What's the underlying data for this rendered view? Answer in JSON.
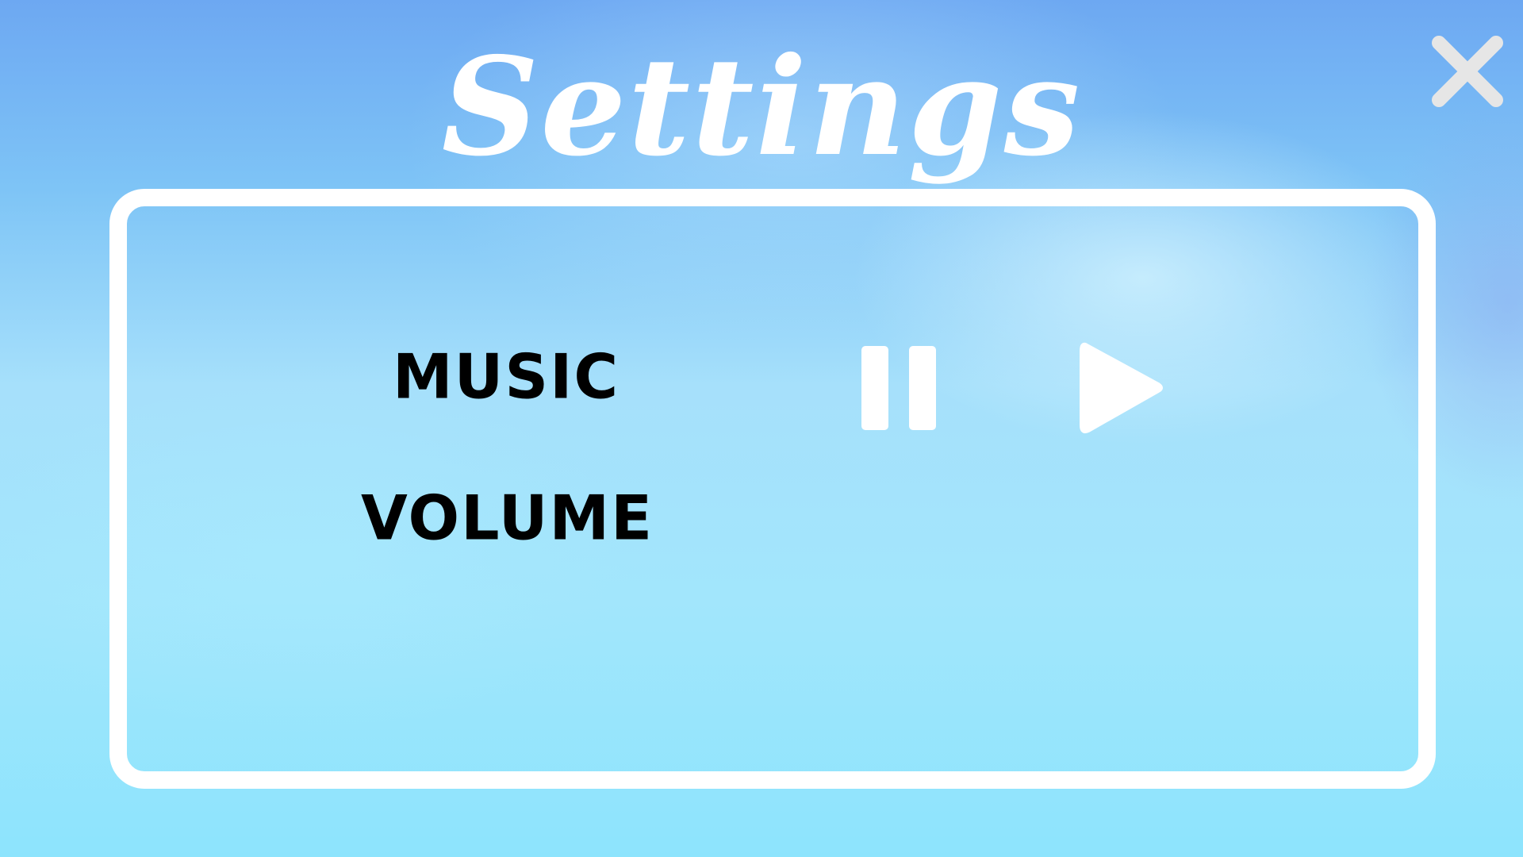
{
  "screen": {
    "title": "Settings"
  },
  "settings": {
    "music_label": "MUSIC",
    "volume_label": "VOLUME"
  },
  "controls": {
    "close_icon": "close-x-icon",
    "pause_icon": "pause-icon",
    "play_icon": "play-icon"
  },
  "colors": {
    "text": "#000000",
    "accent": "#ffffff",
    "close": "#e6e6e6",
    "sky_top": "#6da8f2",
    "sky_bottom": "#8de4fd"
  }
}
